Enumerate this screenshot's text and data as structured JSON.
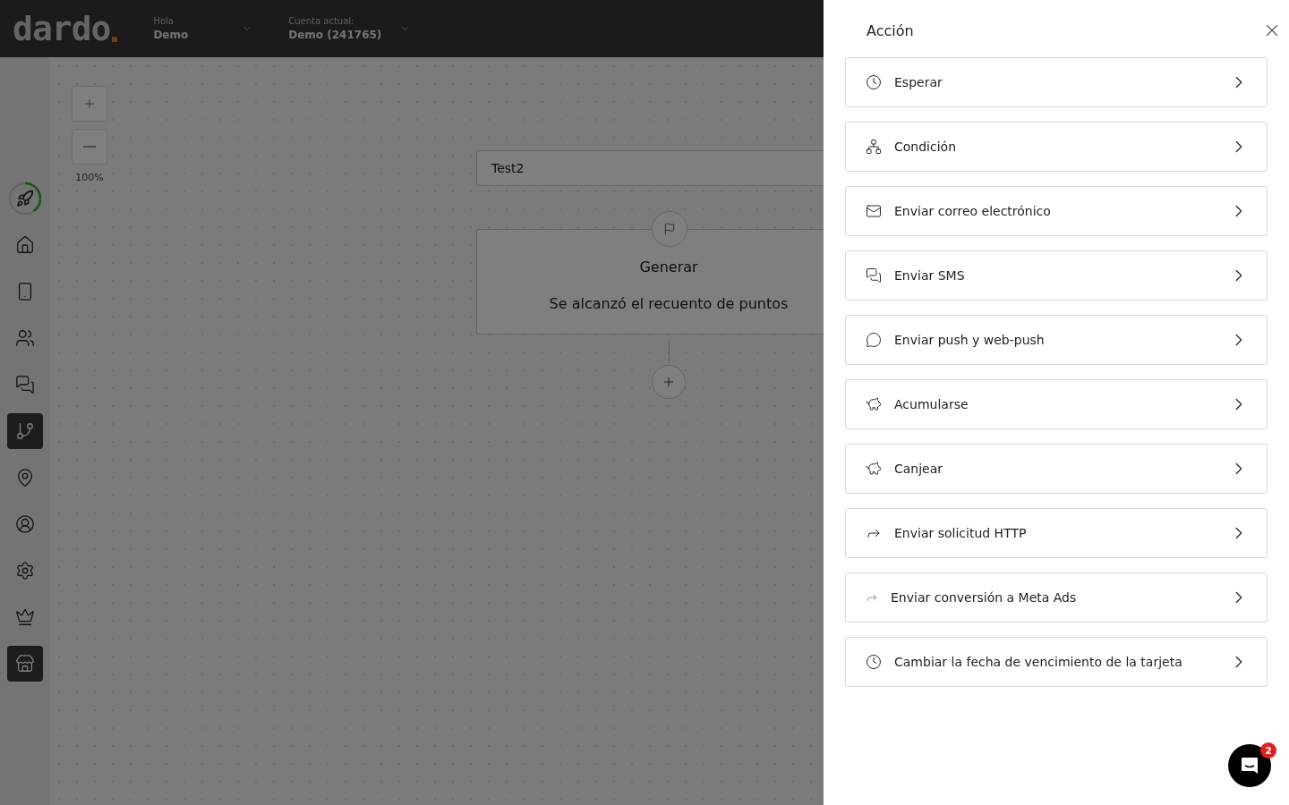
{
  "header": {
    "logo": "dardo",
    "greeting": {
      "label": "Hola",
      "value": "Demo"
    },
    "account": {
      "label": "Cuenta actual:",
      "value": "Demo (241765)"
    }
  },
  "sidebar": {
    "progress": {
      "level": 0.4
    },
    "items": [
      {
        "kind": "home",
        "selected": false
      },
      {
        "kind": "phone",
        "selected": false
      },
      {
        "kind": "users",
        "selected": false
      },
      {
        "kind": "chats",
        "selected": false
      },
      {
        "kind": "flow",
        "selected": true
      },
      {
        "kind": "pin",
        "selected": false
      },
      {
        "kind": "user",
        "selected": false
      },
      {
        "kind": "settings",
        "selected": false
      },
      {
        "kind": "crown",
        "selected": false
      },
      {
        "kind": "store",
        "selected": true
      }
    ]
  },
  "zoom": {
    "level_text": "100%"
  },
  "flow": {
    "name": "Test2",
    "trigger": {
      "title": "Generar",
      "description": "Se alcanzó el recuento de puntos"
    }
  },
  "drawer": {
    "title": "Acción",
    "actions": [
      {
        "kind": "wait",
        "label": "Esperar"
      },
      {
        "kind": "condition",
        "label": "Condición"
      },
      {
        "kind": "email",
        "label": "Enviar correo electrónico"
      },
      {
        "kind": "sms",
        "label": "Enviar SMS"
      },
      {
        "kind": "push",
        "label": "Enviar push y web-push"
      },
      {
        "kind": "piggy",
        "label": "Acumularse"
      },
      {
        "kind": "piggy",
        "label": "Canjear"
      },
      {
        "kind": "http",
        "label": "Enviar solicitud HTTP"
      },
      {
        "kind": "meta",
        "label": "Enviar conversión a Meta Ads"
      },
      {
        "kind": "wait",
        "label": "Cambiar la fecha de vencimiento de la tarjeta"
      }
    ]
  },
  "chat": {
    "badge": "2"
  }
}
